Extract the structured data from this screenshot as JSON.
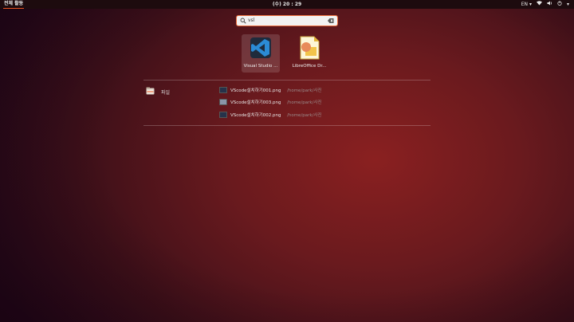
{
  "topbar": {
    "activities": "전체 활동",
    "clock": "(수) 20 : 29",
    "lang": "EN",
    "lang_arrow": "▾",
    "wifi": "wifi-icon",
    "volume": "volume-icon",
    "power": "power-icon",
    "system_arrow": "▾"
  },
  "search": {
    "value": "vsl",
    "placeholder": ""
  },
  "apps": [
    {
      "label": "Visual Studio ...",
      "icon": "vscode-icon",
      "selected": true
    },
    {
      "label": "LibreOffice Dr...",
      "icon": "libreoffice-draw-icon",
      "selected": false
    }
  ],
  "files": {
    "category": "파일",
    "items": [
      {
        "name": "VScode설치하기001.png",
        "path": "/home/park/사진"
      },
      {
        "name": "VScode설치하기003.png",
        "path": "/home/park/사진"
      },
      {
        "name": "VScode설치하기002.png",
        "path": "/home/park/사진"
      }
    ]
  },
  "colors": {
    "accent": "#e95420",
    "vscode_blue": "#2b8bd6"
  }
}
